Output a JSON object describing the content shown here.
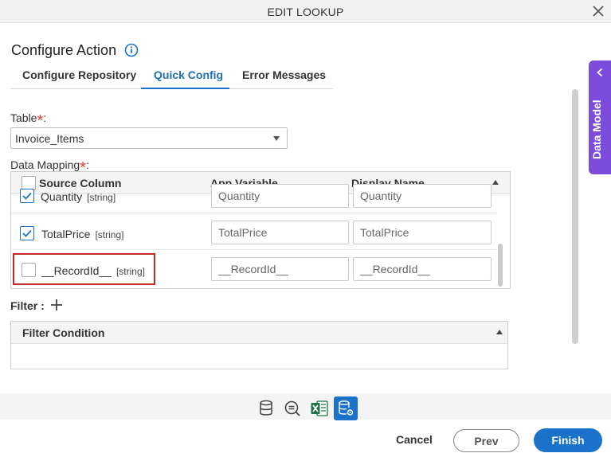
{
  "dialog": {
    "title": "EDIT LOOKUP"
  },
  "page": {
    "heading": "Configure Action"
  },
  "tabs": [
    {
      "label": "Configure Repository"
    },
    {
      "label": "Quick Config"
    },
    {
      "label": "Error Messages"
    }
  ],
  "table_field": {
    "label": "Table",
    "required_mark": "*",
    "suffix": ":",
    "value": "Invoice_Items"
  },
  "data_mapping": {
    "label": "Data Mapping",
    "required_mark": "*",
    "suffix": ":",
    "columns": {
      "source": "Source Column",
      "app_variable": "App Variable",
      "display_name": "Display Name"
    },
    "rows": [
      {
        "checked": true,
        "name": "Quantity",
        "type": "[string]",
        "app_variable": "Quantity",
        "display_name": "Quantity"
      },
      {
        "checked": true,
        "name": "TotalPrice",
        "type": "[string]",
        "app_variable": "TotalPrice",
        "display_name": "TotalPrice"
      },
      {
        "checked": false,
        "name": "__RecordId__",
        "type": "[string]",
        "app_variable": "__RecordId__",
        "display_name": "__RecordId__"
      }
    ]
  },
  "filter": {
    "label": "Filter :",
    "column": "Filter Condition"
  },
  "side_panel": {
    "label": "Data Model"
  },
  "footer_icons": [
    "database-icon",
    "search-list-icon",
    "excel-icon",
    "database-settings-icon"
  ],
  "buttons": {
    "cancel": "Cancel",
    "prev": "Prev",
    "finish": "Finish"
  },
  "colors": {
    "accent": "#1a73c8",
    "panel": "#7c4ddd",
    "required": "#e53935",
    "highlight": "#c62828"
  }
}
